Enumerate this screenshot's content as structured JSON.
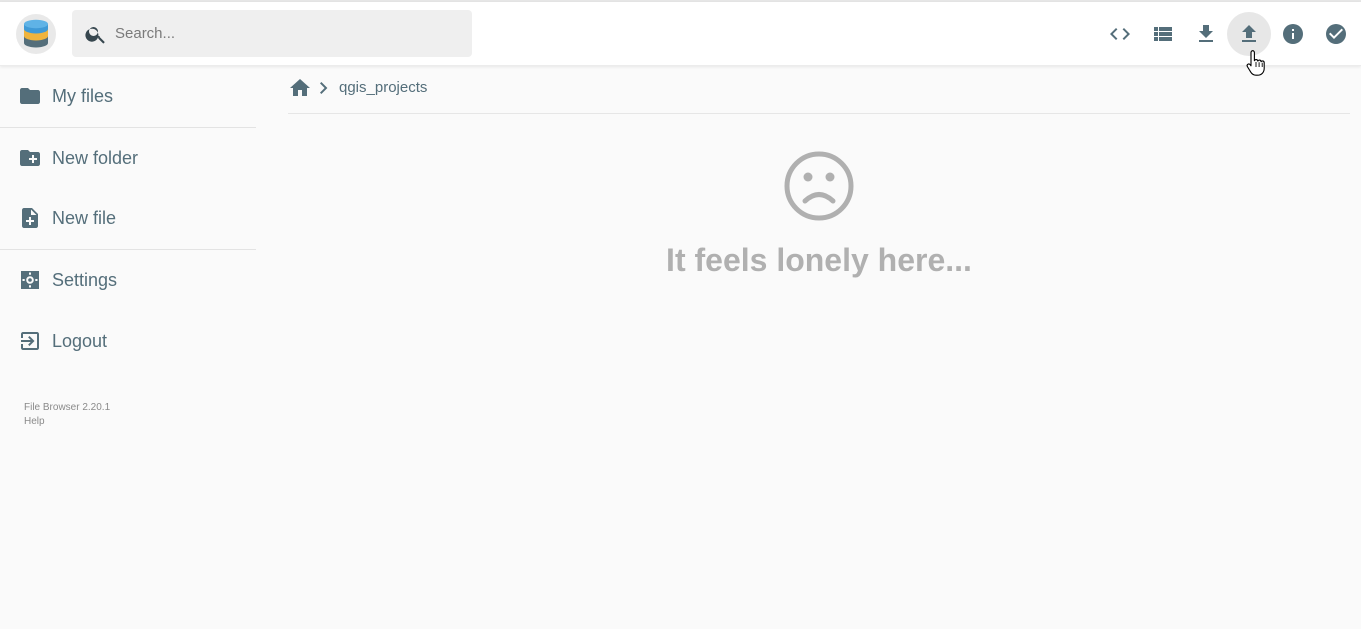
{
  "header": {
    "search": {
      "placeholder": "Search...",
      "value": ""
    },
    "actions": [
      {
        "name": "toggle-source-button",
        "icon": "code-icon"
      },
      {
        "name": "switch-view-button",
        "icon": "view-list-icon"
      },
      {
        "name": "download-button",
        "icon": "download-icon"
      },
      {
        "name": "upload-button",
        "icon": "upload-icon",
        "hovered": true
      },
      {
        "name": "info-button",
        "icon": "info-icon"
      },
      {
        "name": "select-multiple-button",
        "icon": "check-circle-icon"
      }
    ]
  },
  "sidebar": {
    "items": [
      {
        "label": "My files",
        "icon": "folder-icon"
      },
      {
        "label": "New folder",
        "icon": "create-new-folder-icon"
      },
      {
        "label": "New file",
        "icon": "note-add-icon"
      },
      {
        "label": "Settings",
        "icon": "settings-icon"
      },
      {
        "label": "Logout",
        "icon": "exit-to-app-icon"
      }
    ],
    "credits": {
      "version": "File Browser 2.20.1",
      "help": "Help"
    }
  },
  "breadcrumbs": {
    "items": [
      {
        "label": "qgis_projects"
      }
    ]
  },
  "main": {
    "empty_message": "It feels lonely here..."
  },
  "colors": {
    "accent": "#546e7a",
    "muted_text": "#b0b0b0",
    "background": "#fafafa"
  }
}
